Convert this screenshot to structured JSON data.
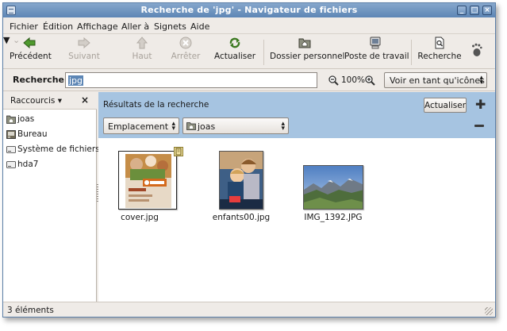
{
  "window": {
    "title": "Recherche de 'jpg' - Navigateur de fichiers"
  },
  "menubar": [
    "Fichier",
    "Édition",
    "Affichage",
    "Aller à",
    "Signets",
    "Aide"
  ],
  "toolbar": {
    "back": "Précédent",
    "forward": "Suivant",
    "up": "Haut",
    "stop": "Arrêter",
    "reload": "Actualiser",
    "home": "Dossier personnel",
    "computer": "Poste de travail",
    "search": "Recherche"
  },
  "location": {
    "label": "Recherche",
    "query": "jpg",
    "zoom": "100%",
    "view_mode": "Voir en tant qu'icônes"
  },
  "sidebar": {
    "title": "Raccourcis",
    "items": [
      {
        "label": "joas",
        "icon": "home-folder-icon"
      },
      {
        "label": "Bureau",
        "icon": "desktop-icon"
      },
      {
        "label": "Système de fichiers",
        "icon": "drive-icon"
      },
      {
        "label": "hda7",
        "icon": "drive-icon"
      }
    ]
  },
  "search": {
    "title": "Résultats de la recherche",
    "refresh": "Actualiser",
    "criterion": "Emplacement",
    "folder": "joas"
  },
  "files": [
    {
      "name": "cover.jpg"
    },
    {
      "name": "enfants00.jpg"
    },
    {
      "name": "IMG_1392.JPG"
    }
  ],
  "status": "3 éléments",
  "colors": {
    "titlebar": "#5d86b5",
    "search_panel": "#a6c4e1",
    "selection": "#5d86b5"
  }
}
